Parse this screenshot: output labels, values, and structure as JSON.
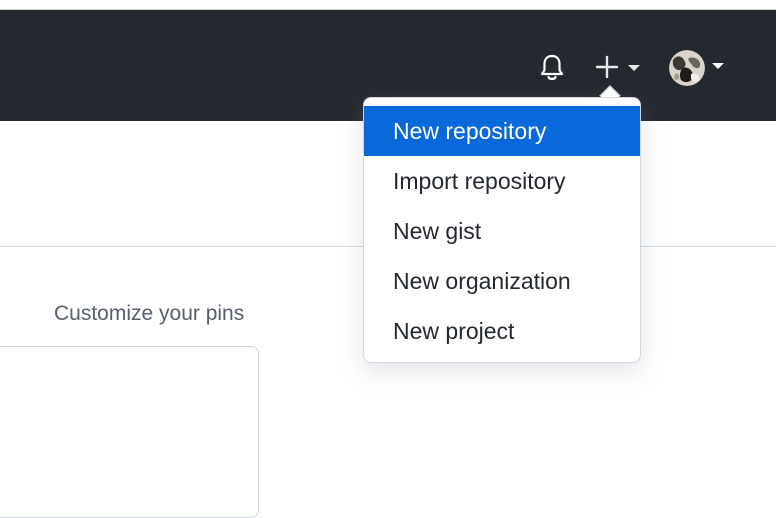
{
  "header": {
    "icons": {
      "notifications": "bell-icon",
      "create": "plus-icon",
      "create_caret": "chevron-down-icon",
      "profile_caret": "chevron-down-icon"
    }
  },
  "create_menu": {
    "items": [
      {
        "label": "New repository",
        "active": true
      },
      {
        "label": "Import repository",
        "active": false
      },
      {
        "label": "New gist",
        "active": false
      },
      {
        "label": "New organization",
        "active": false
      },
      {
        "label": "New project",
        "active": false
      }
    ]
  },
  "main": {
    "customize_pins_label": "Customize your pins"
  },
  "colors": {
    "header_bg": "#24292f",
    "accent": "#0969da",
    "text_muted": "#57606a"
  }
}
